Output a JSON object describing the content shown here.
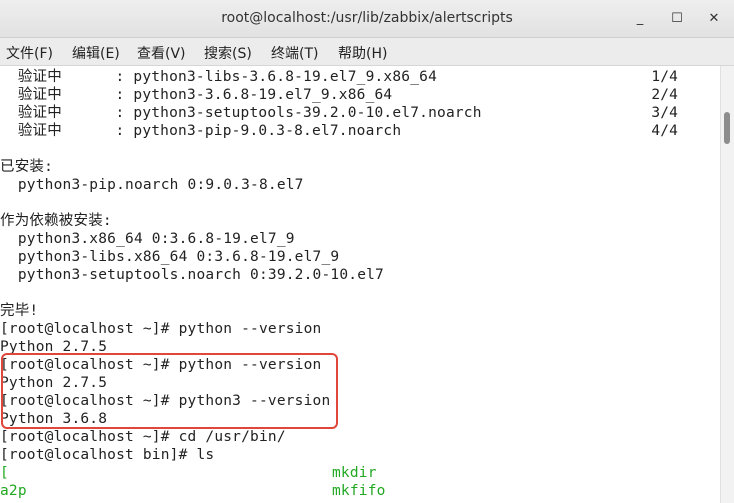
{
  "window": {
    "title": "root@localhost:/usr/lib/zabbix/alertscripts",
    "minimize_icon": "_",
    "maximize_icon": "☐",
    "close_icon": "✕"
  },
  "menu": [
    "文件(F)",
    "编辑(E)",
    "查看(V)",
    "搜索(S)",
    "终端(T)",
    "帮助(H)"
  ],
  "terminal_lines": [
    "  验证中      : python3-libs-3.6.8-19.el7_9.x86_64                        1/4",
    "  验证中      : python3-3.6.8-19.el7_9.x86_64                             2/4",
    "  验证中      : python3-setuptools-39.2.0-10.el7.noarch                   3/4",
    "  验证中      : python3-pip-9.0.3-8.el7.noarch                            4/4",
    "",
    "已安装:",
    "  python3-pip.noarch 0:9.0.3-8.el7",
    "",
    "作为依赖被安装:",
    "  python3.x86_64 0:3.6.8-19.el7_9",
    "  python3-libs.x86_64 0:3.6.8-19.el7_9",
    "  python3-setuptools.noarch 0:39.2.0-10.el7",
    "",
    "完毕!",
    "[root@localhost ~]# python --version",
    "Python 2.7.5",
    "[root@localhost ~]# python --version",
    "Python 2.7.5",
    "[root@localhost ~]# python3 --version",
    "Python 3.6.8",
    "[root@localhost ~]# cd /usr/bin/",
    "[root@localhost bin]# ls"
  ],
  "ls_output": [
    {
      "left": "[",
      "right": "mkdir"
    },
    {
      "left": "a2p",
      "right": "mkfifo"
    }
  ],
  "colors": {
    "highlight_box": "#e0463a",
    "ls_green": "#22a822",
    "text": "#222222"
  }
}
